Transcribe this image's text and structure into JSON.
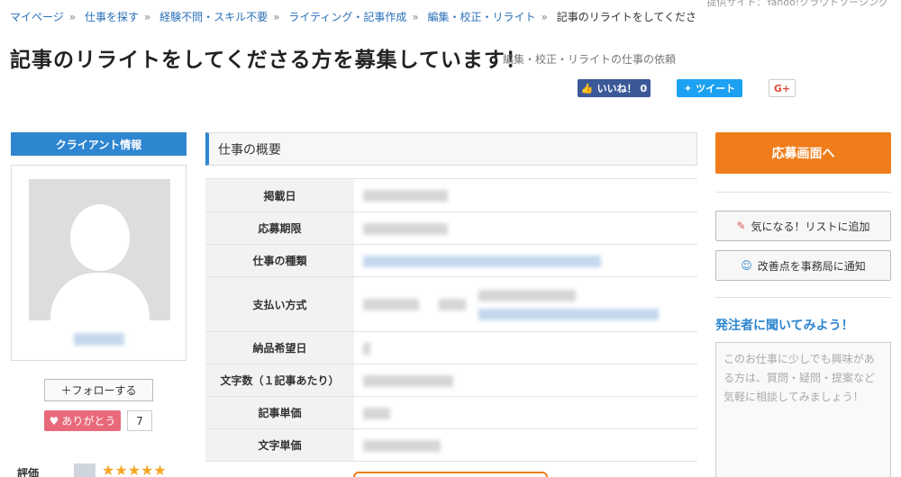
{
  "breadcrumb": [
    "マイページ",
    "仕事を探す",
    "経験不問・スキル不要",
    "ライティング・記事作成",
    "編集・校正・リライト",
    "記事のリライトをしてくださる方を募集し…"
  ],
  "provider": "提供サイト：Yahoo!クラウドソーシング",
  "title": "記事のリライトをしてくださる方を募集しています！",
  "subtitle": "編集・校正・リライトの仕事の依頼",
  "social": {
    "like": "いいね！ 0",
    "tweet": "ツイート",
    "gplus": "G+"
  },
  "client": {
    "header": "クライアント情報",
    "follow": "＋フォローする",
    "thanks": "ありがとう",
    "thanks_count": "7",
    "rating_label": "評価",
    "stars": "★★★★★"
  },
  "summary": {
    "title": "仕事の概要",
    "rows": [
      {
        "label": "掲載日"
      },
      {
        "label": "応募期限"
      },
      {
        "label": "仕事の種類"
      },
      {
        "label": "支払い方式"
      },
      {
        "label": "納品希望日"
      },
      {
        "label": "文字数（１記事あたり）"
      },
      {
        "label": "記事単価"
      },
      {
        "label": "文字単価"
      }
    ]
  },
  "side": {
    "apply": "応募画面へ",
    "bookmark": "気になる！リストに追加",
    "report": "改善点を事務局に通知",
    "ask_title": "発注者に聞いてみよう！",
    "ask_placeholder": "このお仕事に少しでも興味がある方は、質問・疑問・提案など気軽に相談してみましょう！"
  },
  "colors": {
    "accent": "#2e86d0",
    "cta": "#ef7d1b",
    "link": "#2a6fb8"
  }
}
